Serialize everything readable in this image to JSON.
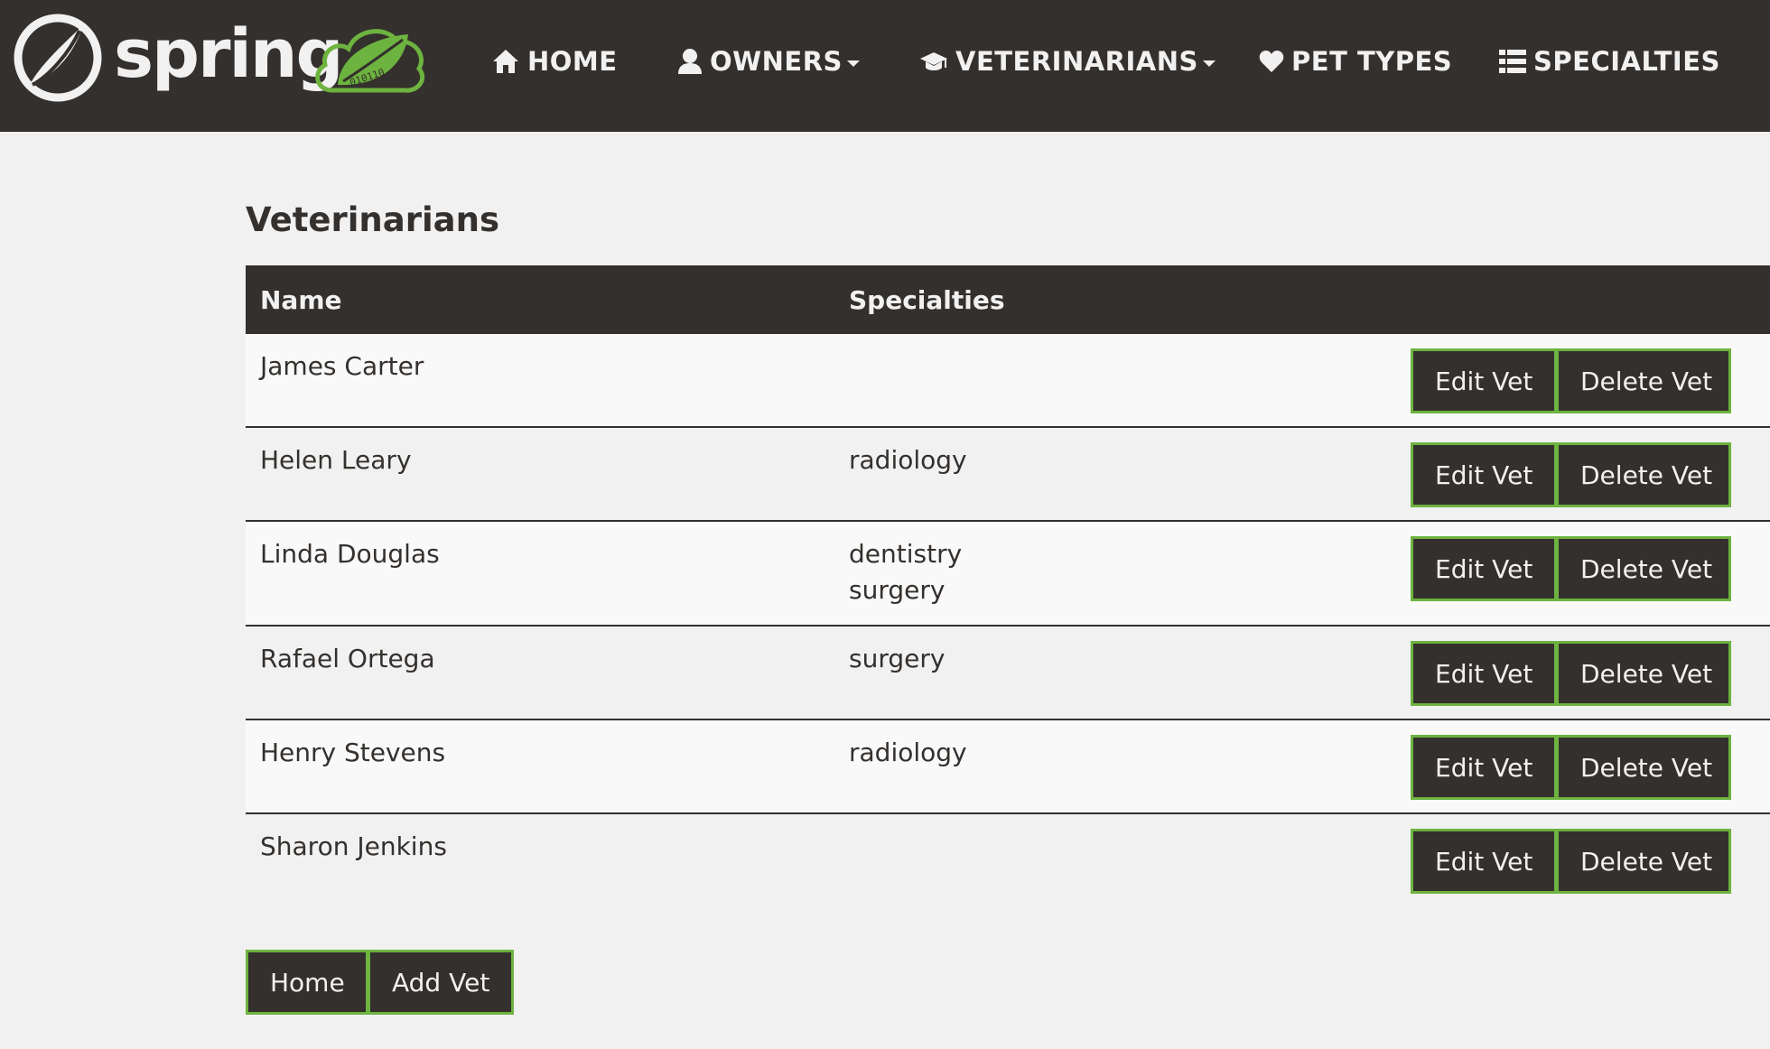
{
  "colors": {
    "nav_bg": "#34302d",
    "page_bg": "#f1f1f1",
    "accent_green": "#6db33f",
    "text_light": "#f1f1f1"
  },
  "brand": {
    "name": "spring"
  },
  "nav": {
    "items": [
      {
        "label": "HOME",
        "icon": "home-icon"
      },
      {
        "label": "OWNERS",
        "icon": "user-icon",
        "dropdown": true
      },
      {
        "label": "VETERINARIANS",
        "icon": "graduation-cap-icon",
        "dropdown": true
      },
      {
        "label": "PET TYPES",
        "icon": "heart-icon"
      },
      {
        "label": "SPECIALTIES",
        "icon": "list-icon"
      }
    ]
  },
  "page": {
    "title": "Veterinarians"
  },
  "table": {
    "headers": {
      "name": "Name",
      "specialties": "Specialties"
    },
    "edit_label": "Edit Vet",
    "delete_label": "Delete Vet",
    "rows": [
      {
        "name": "James Carter",
        "specialties": []
      },
      {
        "name": "Helen Leary",
        "specialties": [
          "radiology"
        ]
      },
      {
        "name": "Linda Douglas",
        "specialties": [
          "dentistry",
          "surgery"
        ]
      },
      {
        "name": "Rafael Ortega",
        "specialties": [
          "surgery"
        ]
      },
      {
        "name": "Henry Stevens",
        "specialties": [
          "radiology"
        ]
      },
      {
        "name": "Sharon Jenkins",
        "specialties": []
      }
    ]
  },
  "footer_buttons": {
    "home_label": "Home",
    "add_label": "Add Vet"
  }
}
